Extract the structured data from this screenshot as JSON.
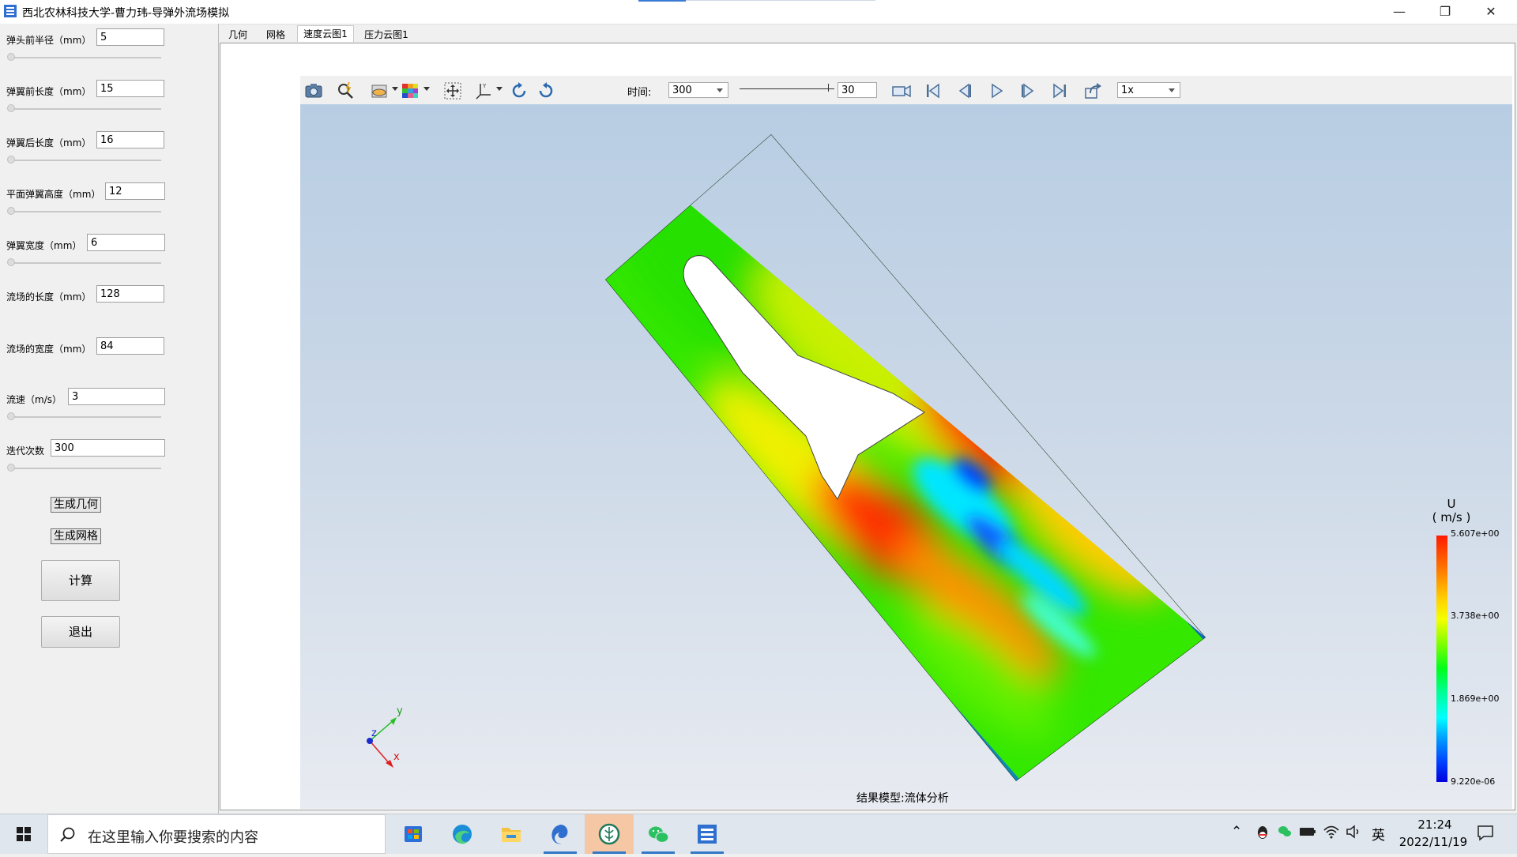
{
  "window": {
    "title": "西北农林科技大学-曹力玮-导弹外流场模拟",
    "minimize": "—",
    "restore": "❐",
    "close": "✕"
  },
  "params": [
    {
      "label": "弹头前半径（mm）",
      "value": "5",
      "slider": true
    },
    {
      "label": "弹翼前长度（mm）",
      "value": "15",
      "slider": true
    },
    {
      "label": "弹翼后长度（mm）",
      "value": "16",
      "slider": true
    },
    {
      "label": "平面弹翼高度（mm）",
      "value": "12",
      "slider": true
    },
    {
      "label": "弹翼宽度（mm）",
      "value": "6",
      "slider": true
    },
    {
      "label": "流场的长度（mm）",
      "value": "128",
      "slider": false
    },
    {
      "label": "流场的宽度（mm）",
      "value": "84",
      "slider": false
    },
    {
      "label": "流速（m/s）",
      "value": "3",
      "slider": true
    },
    {
      "label": "迭代次数",
      "value": "300",
      "slider": true
    }
  ],
  "buttons": {
    "gen_geometry": "生成几何",
    "gen_mesh": "生成网格",
    "compute": "计算",
    "exit": "退出"
  },
  "tabs": [
    "几何",
    "网格",
    "速度云图1",
    "压力云图1"
  ],
  "active_tab": 2,
  "toolbar": {
    "time_label": "时间:",
    "time_value": "300",
    "frame_value": "30",
    "speed_value": "1x"
  },
  "viewer": {
    "result_label": "结果模型:流体分析",
    "axes": {
      "y": "y",
      "z": "z",
      "x": "x"
    }
  },
  "legend": {
    "title_line1": "U",
    "title_line2": "( m/s )",
    "ticks": [
      "5.607e+00",
      "3.738e+00",
      "1.869e+00",
      "9.220e-06"
    ]
  },
  "taskbar": {
    "search_placeholder": "在这里输入你要搜索的内容",
    "ime": "英",
    "time": "21:24",
    "date": "2022/11/19"
  }
}
